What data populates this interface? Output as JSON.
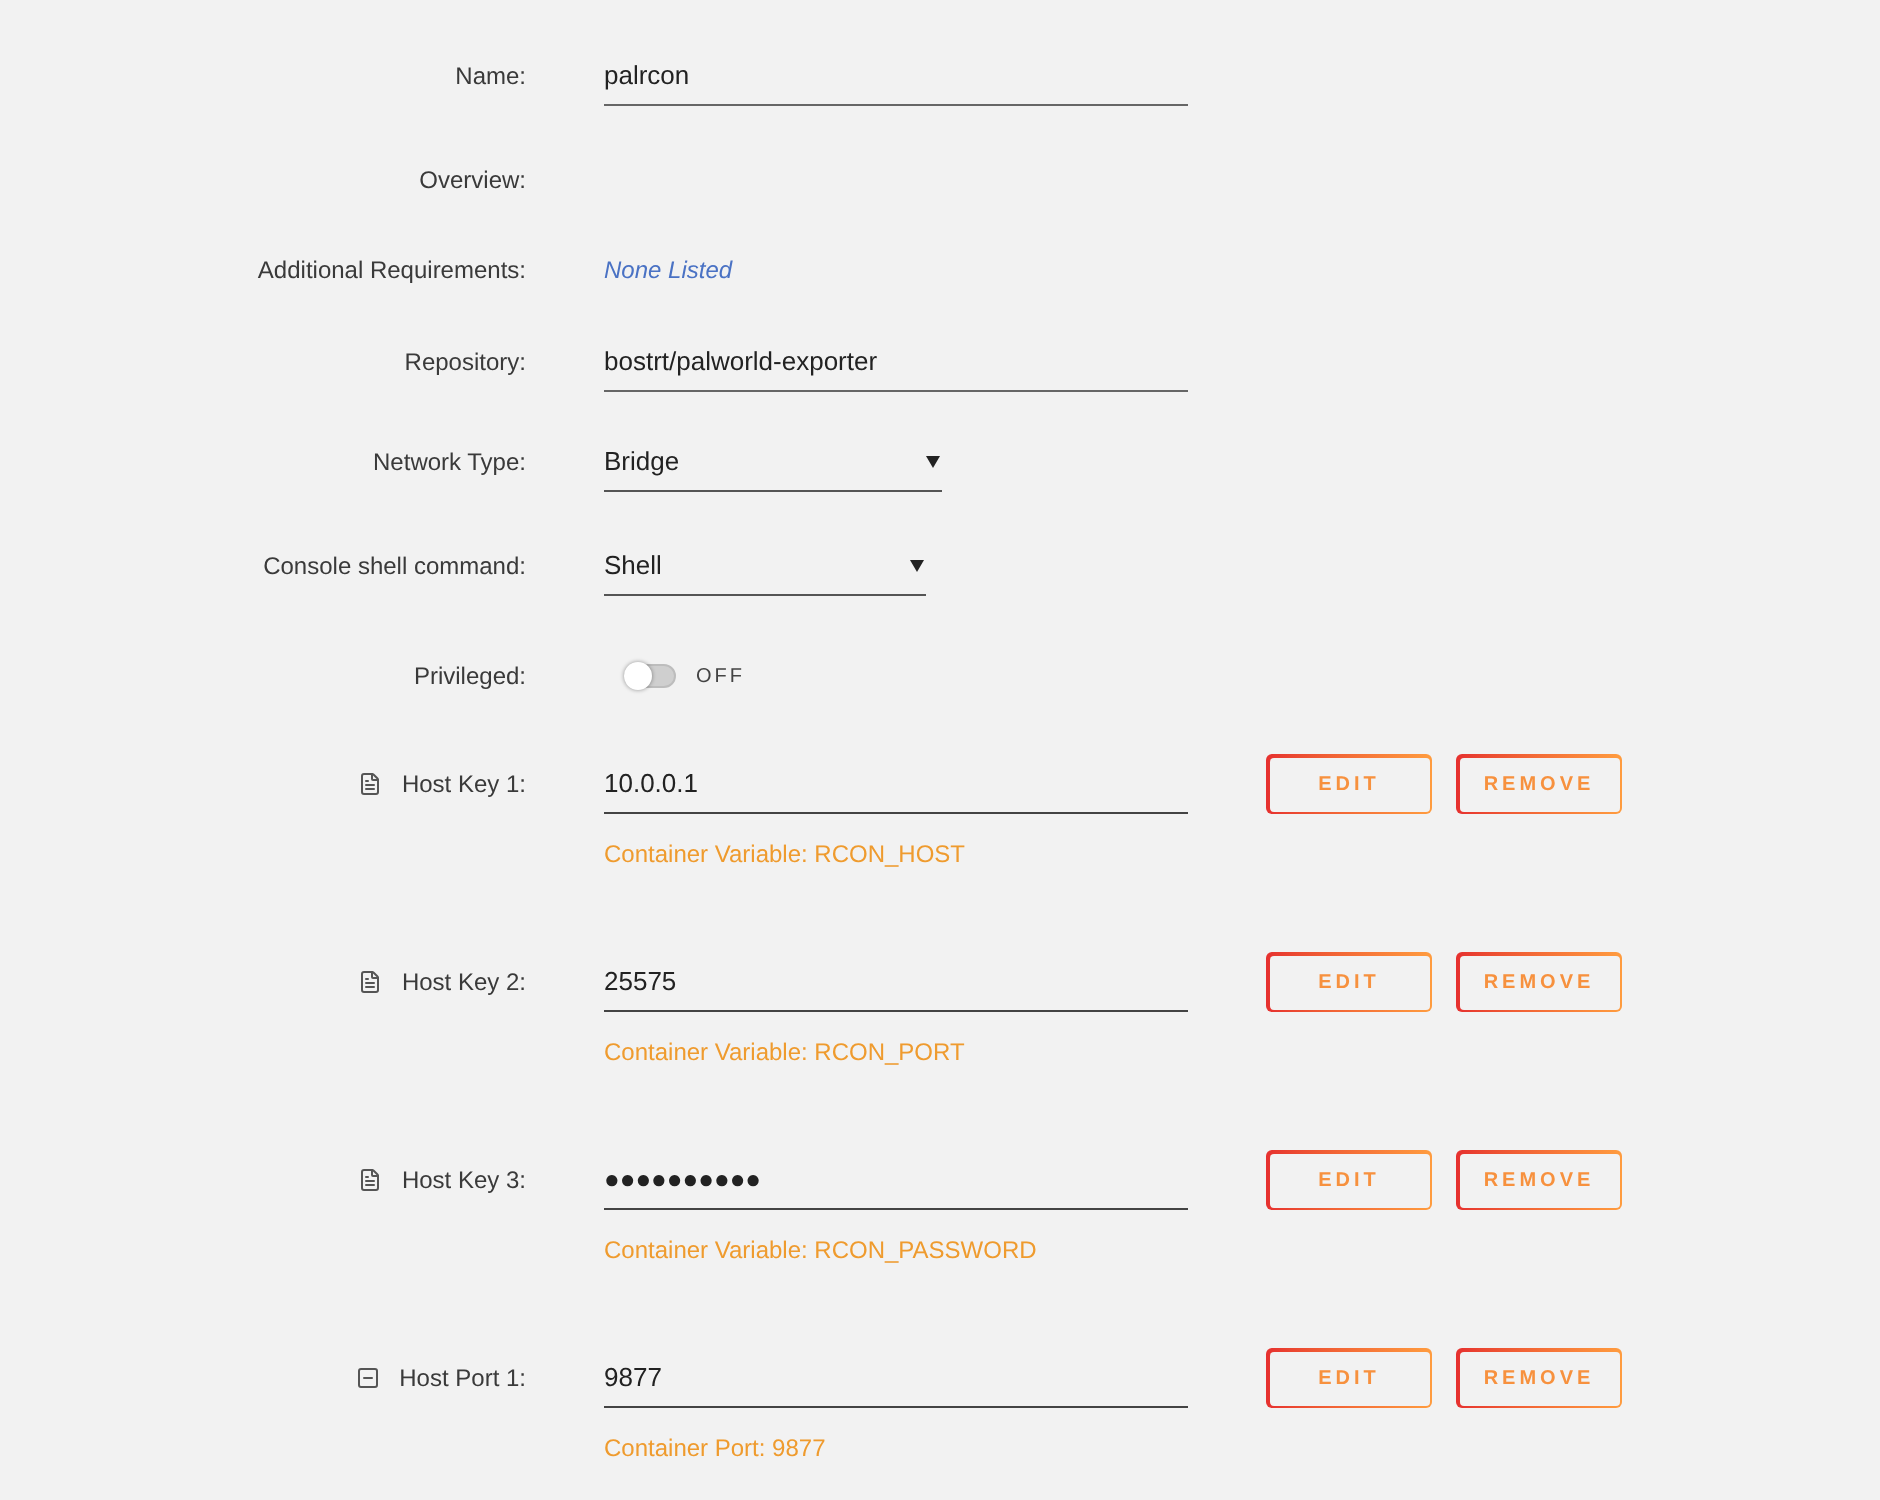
{
  "fields": [
    {
      "kind": "text",
      "label": "Name:",
      "value": "palrcon"
    },
    {
      "kind": "empty",
      "label": "Overview:"
    },
    {
      "kind": "note",
      "label": "Additional Requirements:",
      "value": "None Listed"
    },
    {
      "kind": "text",
      "label": "Repository:",
      "value": "bostrt/palworld-exporter"
    },
    {
      "kind": "select",
      "label": "Network Type:",
      "value": "Bridge"
    },
    {
      "kind": "select",
      "label": "Console shell command:",
      "value": "Shell"
    },
    {
      "kind": "toggle",
      "label": "Privileged:",
      "on": false,
      "state_text": "OFF"
    }
  ],
  "mappings": [
    {
      "kind": "variable",
      "label": "Host Key 1:",
      "value": "10.0.0.1",
      "hint": "Container Variable: RCON_HOST",
      "buttons": [
        "EDIT",
        "REMOVE"
      ]
    },
    {
      "kind": "variable",
      "label": "Host Key 2:",
      "value": "25575",
      "hint": "Container Variable: RCON_PORT",
      "buttons": [
        "EDIT",
        "REMOVE"
      ]
    },
    {
      "kind": "variable",
      "label": "Host Key 3:",
      "value": "●●●●●●●●●●",
      "hint": "Container Variable: RCON_PASSWORD",
      "buttons": [
        "EDIT",
        "REMOVE"
      ]
    },
    {
      "kind": "port",
      "label": "Host Port 1:",
      "value": "9877",
      "hint": "Container Port: 9877",
      "buttons": [
        "EDIT",
        "REMOVE"
      ]
    }
  ]
}
